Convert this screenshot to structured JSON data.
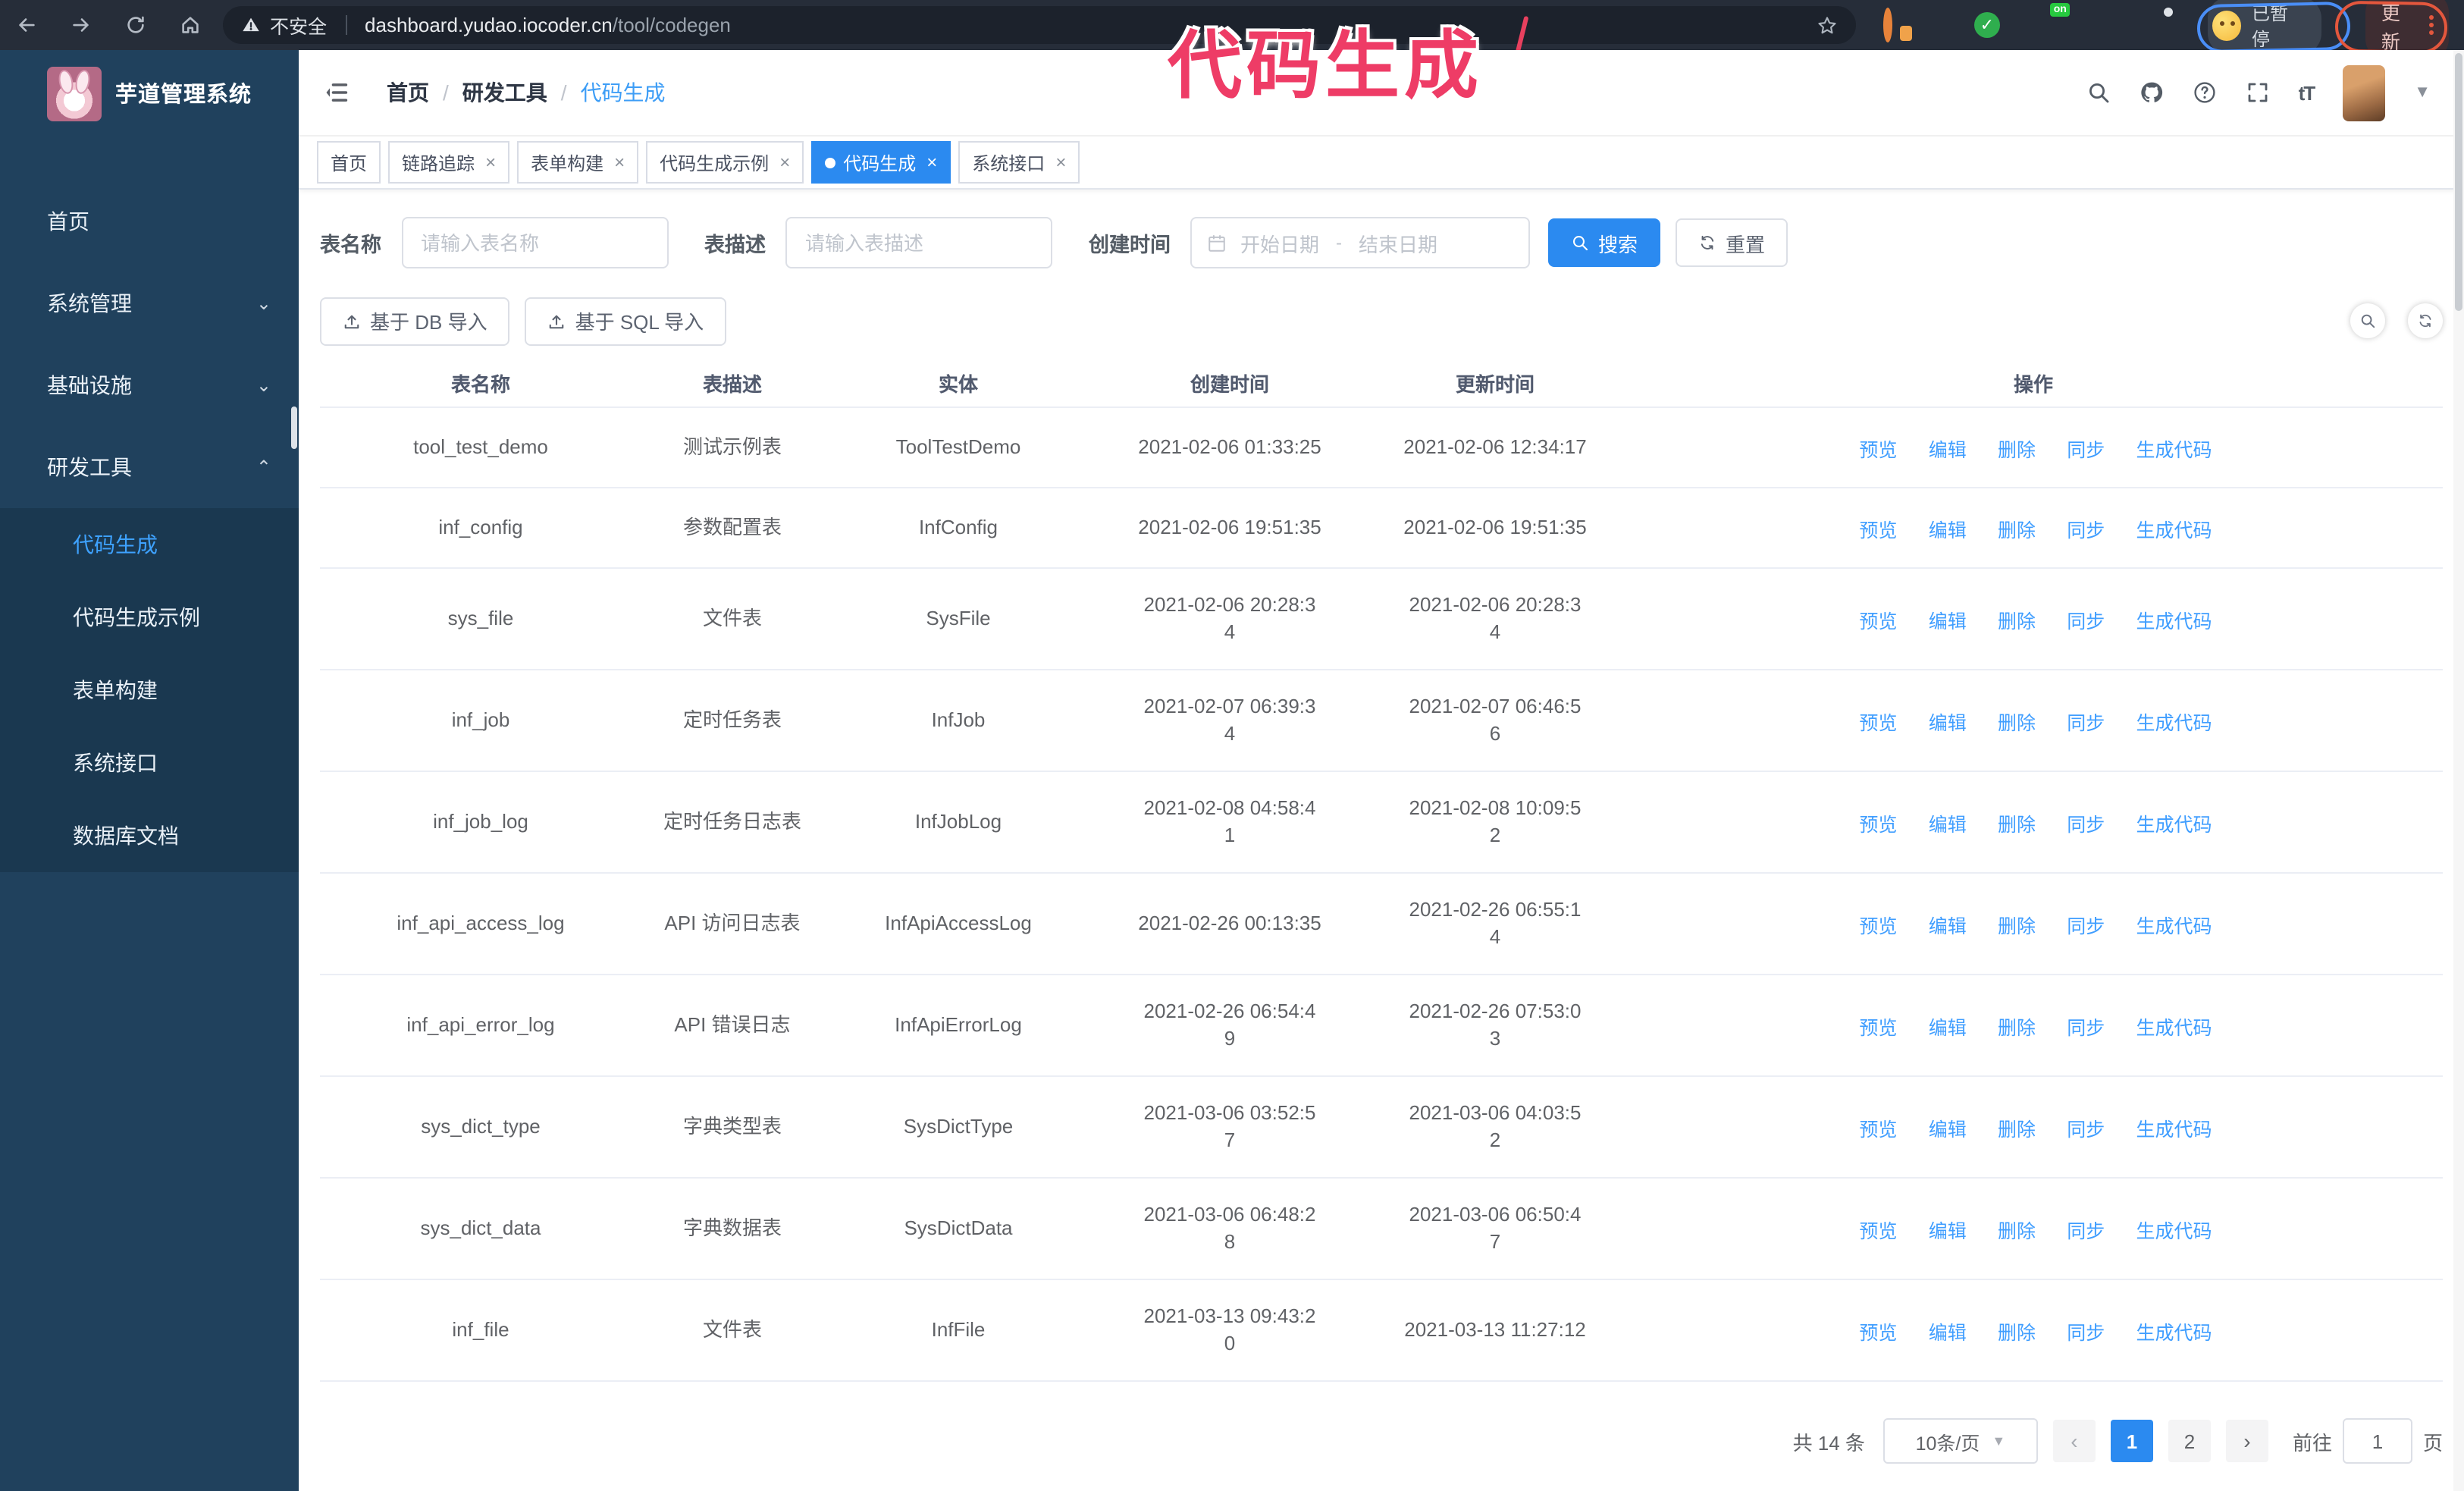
{
  "annotation": {
    "text": "代码生成",
    "color": "#ee3c66",
    "arrow_color": "#e8405e"
  },
  "browser": {
    "security_label": "不安全",
    "url_domain": "dashboard.yudao.iocoder.cn",
    "url_path": "/tool/codegen",
    "profile_badge": "已暂停",
    "update_label": "更新"
  },
  "sidebar": {
    "title": "芋道管理系统",
    "items": [
      {
        "label": "首页",
        "icon": "dashboard-icon"
      },
      {
        "label": "系统管理",
        "icon": "gear-icon",
        "chevron": "down"
      },
      {
        "label": "基础设施",
        "icon": "monitor-icon",
        "chevron": "down"
      },
      {
        "label": "研发工具",
        "icon": "toolbox-icon",
        "chevron": "up"
      }
    ],
    "subitems": [
      {
        "label": "代码生成",
        "icon": "code-icon",
        "active": true
      },
      {
        "label": "代码生成示例",
        "icon": "shield-icon"
      },
      {
        "label": "表单构建",
        "icon": "form-icon"
      },
      {
        "label": "系统接口",
        "icon": "sliders-icon"
      },
      {
        "label": "数据库文档",
        "icon": "library-icon"
      }
    ]
  },
  "header": {
    "breadcrumb": [
      "首页",
      "研发工具",
      "代码生成"
    ]
  },
  "tabs": [
    {
      "label": "首页",
      "closable": false,
      "active": false
    },
    {
      "label": "链路追踪",
      "closable": true,
      "active": false
    },
    {
      "label": "表单构建",
      "closable": true,
      "active": false
    },
    {
      "label": "代码生成示例",
      "closable": true,
      "active": false
    },
    {
      "label": "代码生成",
      "closable": true,
      "active": true
    },
    {
      "label": "系统接口",
      "closable": true,
      "active": false
    }
  ],
  "filters": {
    "name_label": "表名称",
    "name_placeholder": "请输入表名称",
    "desc_label": "表描述",
    "desc_placeholder": "请输入表描述",
    "time_label": "创建时间",
    "start_placeholder": "开始日期",
    "range_separator": "-",
    "end_placeholder": "结束日期",
    "search_label": "搜索",
    "reset_label": "重置"
  },
  "toolbar": {
    "db_import_label": "基于 DB 导入",
    "sql_import_label": "基于 SQL 导入"
  },
  "table": {
    "columns": [
      "表名称",
      "表描述",
      "实体",
      "创建时间",
      "更新时间",
      "操作"
    ],
    "actions": [
      "预览",
      "编辑",
      "删除",
      "同步",
      "生成代码"
    ],
    "rows": [
      {
        "name": "tool_test_demo",
        "desc": "测试示例表",
        "entity": "ToolTestDemo",
        "created": "2021-02-06 01:33:25",
        "updated": "2021-02-06 12:34:17"
      },
      {
        "name": "inf_config",
        "desc": "参数配置表",
        "entity": "InfConfig",
        "created": "2021-02-06 19:51:35",
        "updated": "2021-02-06 19:51:35"
      },
      {
        "name": "sys_file",
        "desc": "文件表",
        "entity": "SysFile",
        "created": "2021-02-06 20:28:3\n4",
        "updated": "2021-02-06 20:28:3\n4"
      },
      {
        "name": "inf_job",
        "desc": "定时任务表",
        "entity": "InfJob",
        "created": "2021-02-07 06:39:3\n4",
        "updated": "2021-02-07 06:46:5\n6"
      },
      {
        "name": "inf_job_log",
        "desc": "定时任务日志表",
        "entity": "InfJobLog",
        "created": "2021-02-08 04:58:4\n1",
        "updated": "2021-02-08 10:09:5\n2"
      },
      {
        "name": "inf_api_access_log",
        "desc": "API 访问日志表",
        "entity": "InfApiAccessLog",
        "created": "2021-02-26 00:13:35",
        "updated": "2021-02-26 06:55:1\n4"
      },
      {
        "name": "inf_api_error_log",
        "desc": "API 错误日志",
        "entity": "InfApiErrorLog",
        "created": "2021-02-26 06:54:4\n9",
        "updated": "2021-02-26 07:53:0\n3"
      },
      {
        "name": "sys_dict_type",
        "desc": "字典类型表",
        "entity": "SysDictType",
        "created": "2021-03-06 03:52:5\n7",
        "updated": "2021-03-06 04:03:5\n2"
      },
      {
        "name": "sys_dict_data",
        "desc": "字典数据表",
        "entity": "SysDictData",
        "created": "2021-03-06 06:48:2\n8",
        "updated": "2021-03-06 06:50:4\n7"
      },
      {
        "name": "inf_file",
        "desc": "文件表",
        "entity": "InfFile",
        "created": "2021-03-13 09:43:2\n0",
        "updated": "2021-03-13 11:27:12"
      }
    ]
  },
  "pagination": {
    "total_label": "共 14 条",
    "page_size": "10条/页",
    "pages": [
      "1",
      "2"
    ],
    "active_page": "1",
    "prev_label": "‹",
    "next_label": "›",
    "goto_label": "前往",
    "goto_value": "1",
    "page_suffix_label": "页"
  },
  "colors": {
    "accent": "#2b8af0",
    "link_blue": "#409eff",
    "sidebar_bg": "#20415d",
    "submenu_bg": "#1a3850",
    "browser_bar_bg": "#262d39",
    "annotation_pink": "#ee3c66",
    "table_border": "#ebeef5"
  },
  "icons": {
    "back-icon": "←",
    "forward-icon": "→",
    "reload-icon": "⟳",
    "home-icon": "⌂",
    "warning-icon": "⚠",
    "star-icon": "☆",
    "cookie-extension-icon": "orange-ring",
    "gem-extension-icon": "blue-diamond",
    "adblock-extension-icon": "green-check",
    "grid-extension-icon": "grey-grid",
    "switch-extension-icon": "dark-on-box",
    "leaf-extension-icon": "green-leaf",
    "puzzle-extension-icon": "grey-puzzle",
    "search-icon": "magnifier",
    "github-icon": "octocat",
    "help-icon": "?-circle",
    "fullscreen-icon": "corners",
    "font-size-icon": "tT",
    "caret-down-icon": "▾",
    "hamburger-icon": "☰",
    "calendar-icon": "▦",
    "upload-icon": "⬆",
    "refresh-icon": "⟳",
    "dashboard-icon": "pie",
    "gear-icon": "⚙",
    "monitor-icon": "screen",
    "toolbox-icon": "case",
    "code-icon": "</>",
    "shield-icon": "shield-check",
    "form-icon": "grid",
    "sliders-icon": "knobs",
    "library-icon": "columns",
    "eye-icon": "eye",
    "edit-icon": "pencil",
    "delete-icon": "trash",
    "sync-icon": "cycle",
    "download-icon": "⤓"
  }
}
